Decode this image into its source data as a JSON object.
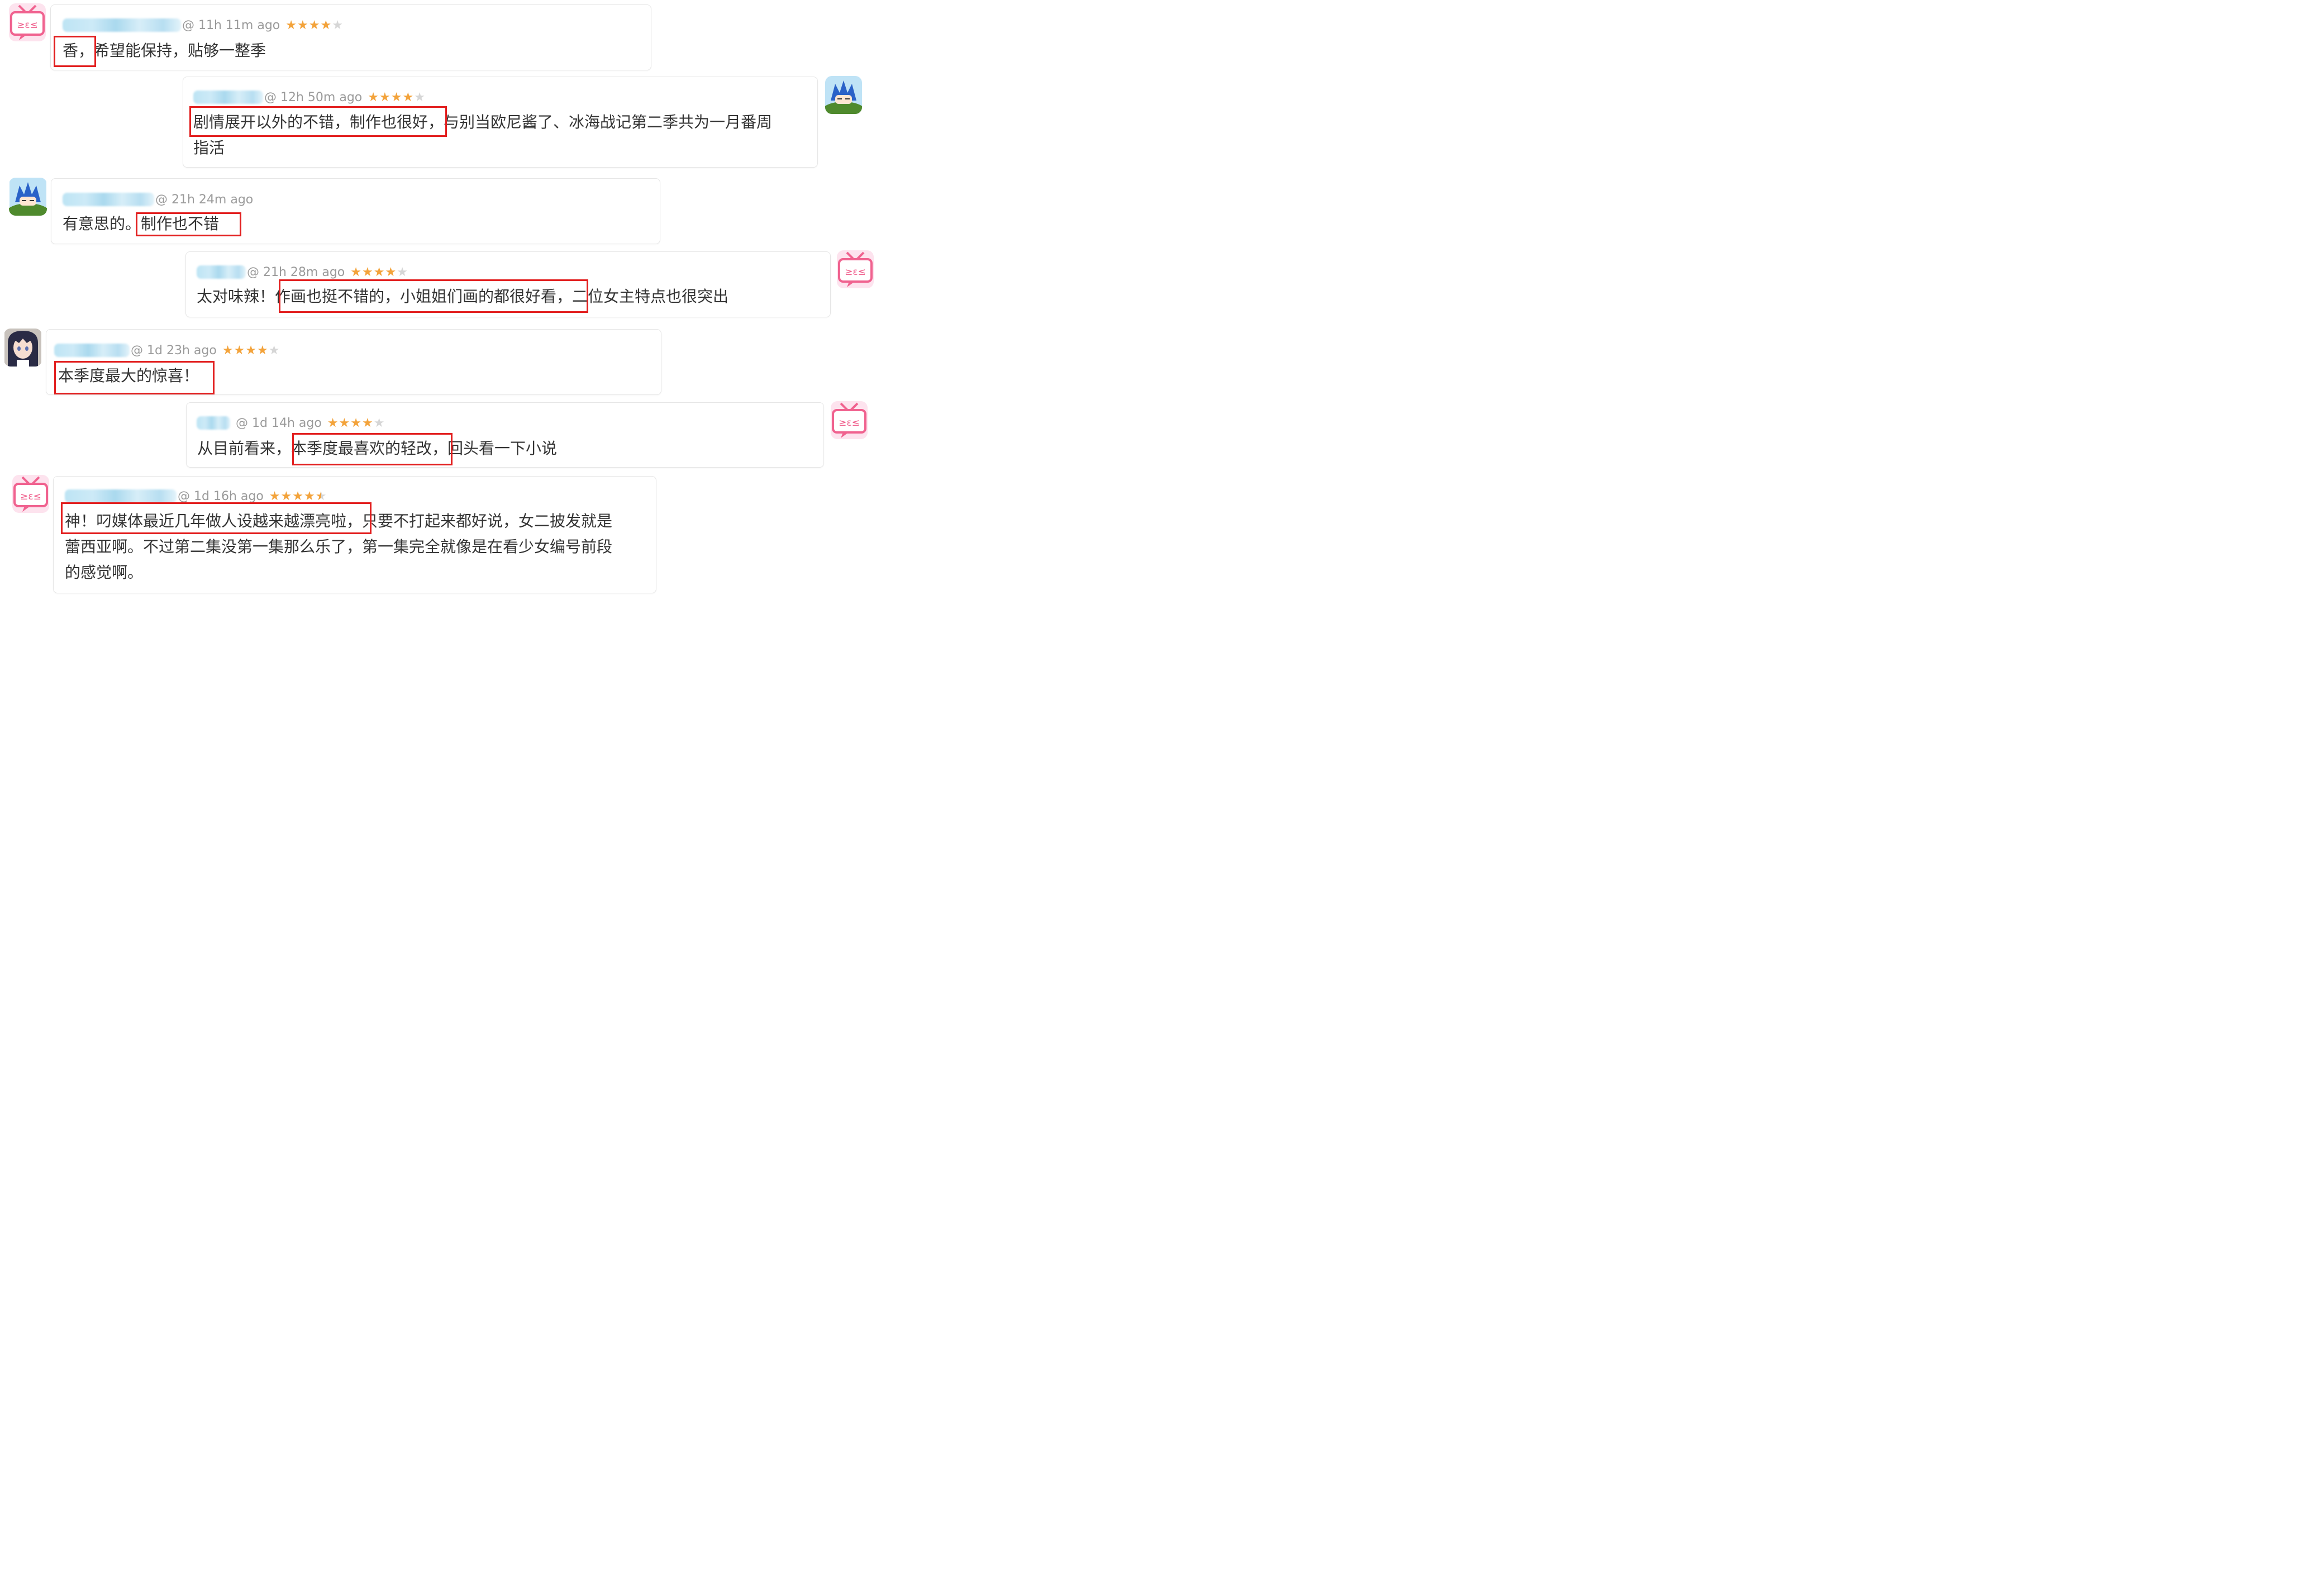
{
  "comments": [
    {
      "id": "c1",
      "avatar": "tv-icon",
      "timestamp": "@ 11h 11m ago",
      "rating": 4,
      "lines": [
        [
          "香，",
          "希望能保持，贴够一整季"
        ]
      ]
    },
    {
      "id": "c2",
      "avatar": "blue-hair-icon",
      "timestamp": "@ 12h 50m ago",
      "rating": 4,
      "lines": [
        [
          "剧情展开以外的不错，制作也很好，",
          "与别当欧尼酱了、冰海战记第二季共为一月番周"
        ],
        [
          "指活"
        ]
      ]
    },
    {
      "id": "c3",
      "avatar": "blue-hair-icon",
      "timestamp": "@ 21h 24m ago",
      "rating": 0,
      "lines": [
        [
          "有意思的。",
          "制作也不错"
        ]
      ]
    },
    {
      "id": "c4",
      "avatar": "tv-icon",
      "timestamp": "@ 21h 28m ago",
      "rating": 4,
      "lines": [
        [
          "太对味辣！",
          "作画也挺不错的，小姐姐们画的都很好看，",
          "二位女主特点也很突出"
        ]
      ]
    },
    {
      "id": "c5",
      "avatar": "anime-girl-icon",
      "timestamp": "@ 1d 23h ago",
      "rating": 4,
      "lines": [
        [
          "本季度最大的惊喜！"
        ]
      ]
    },
    {
      "id": "c6",
      "avatar": "tv-icon",
      "timestamp": "@ 1d 14h ago",
      "rating": 4,
      "lines": [
        [
          "从目前看来，",
          "本季度最喜欢的轻改，",
          "回头看一下小说"
        ]
      ]
    },
    {
      "id": "c7",
      "avatar": "tv-icon",
      "timestamp": "@ 1d 16h ago",
      "rating": 4.5,
      "lines": [
        [
          "神！叼媒体最近几年做人设越来越漂亮啦，",
          "只要不打起来都好说，女二披发就是"
        ],
        [
          "蕾西亚啊。不过第二集没第一集那么乐了，第一集完全就像是在看少女编号前段"
        ],
        [
          "的感觉啊。"
        ]
      ]
    }
  ],
  "colors": {
    "highlight_box": "#e21f1f",
    "star_filled": "#f3a33b",
    "star_empty": "#d6d6d6",
    "timestamp_text": "#9a9a9a",
    "comment_text": "#333333",
    "card_border": "#e6e6e6"
  }
}
